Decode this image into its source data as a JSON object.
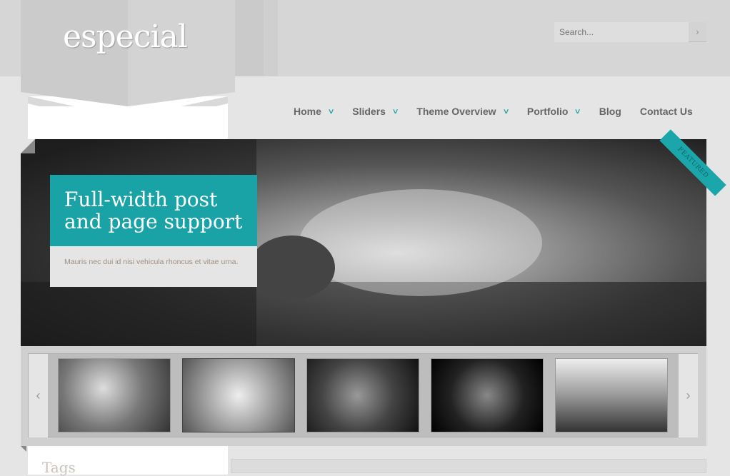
{
  "logo": "especial",
  "search": {
    "placeholder": "Search...",
    "button": "›"
  },
  "nav": [
    {
      "label": "Home",
      "dropdown": true
    },
    {
      "label": "Sliders",
      "dropdown": true
    },
    {
      "label": "Theme Overview",
      "dropdown": true
    },
    {
      "label": "Portfolio",
      "dropdown": true
    },
    {
      "label": "Blog",
      "dropdown": false
    },
    {
      "label": "Contact Us",
      "dropdown": false
    }
  ],
  "slider": {
    "title": "Full-width post and page support",
    "text": "Mauris nec dui id nisi vehicula rhoncus et vitae urna.",
    "badge": "FEATURED"
  },
  "thumbnails": {
    "prev": "‹",
    "next": "›",
    "count": 5
  },
  "sidebar": {
    "heading": "Tags"
  },
  "colors": {
    "accent": "#19a3a6"
  }
}
